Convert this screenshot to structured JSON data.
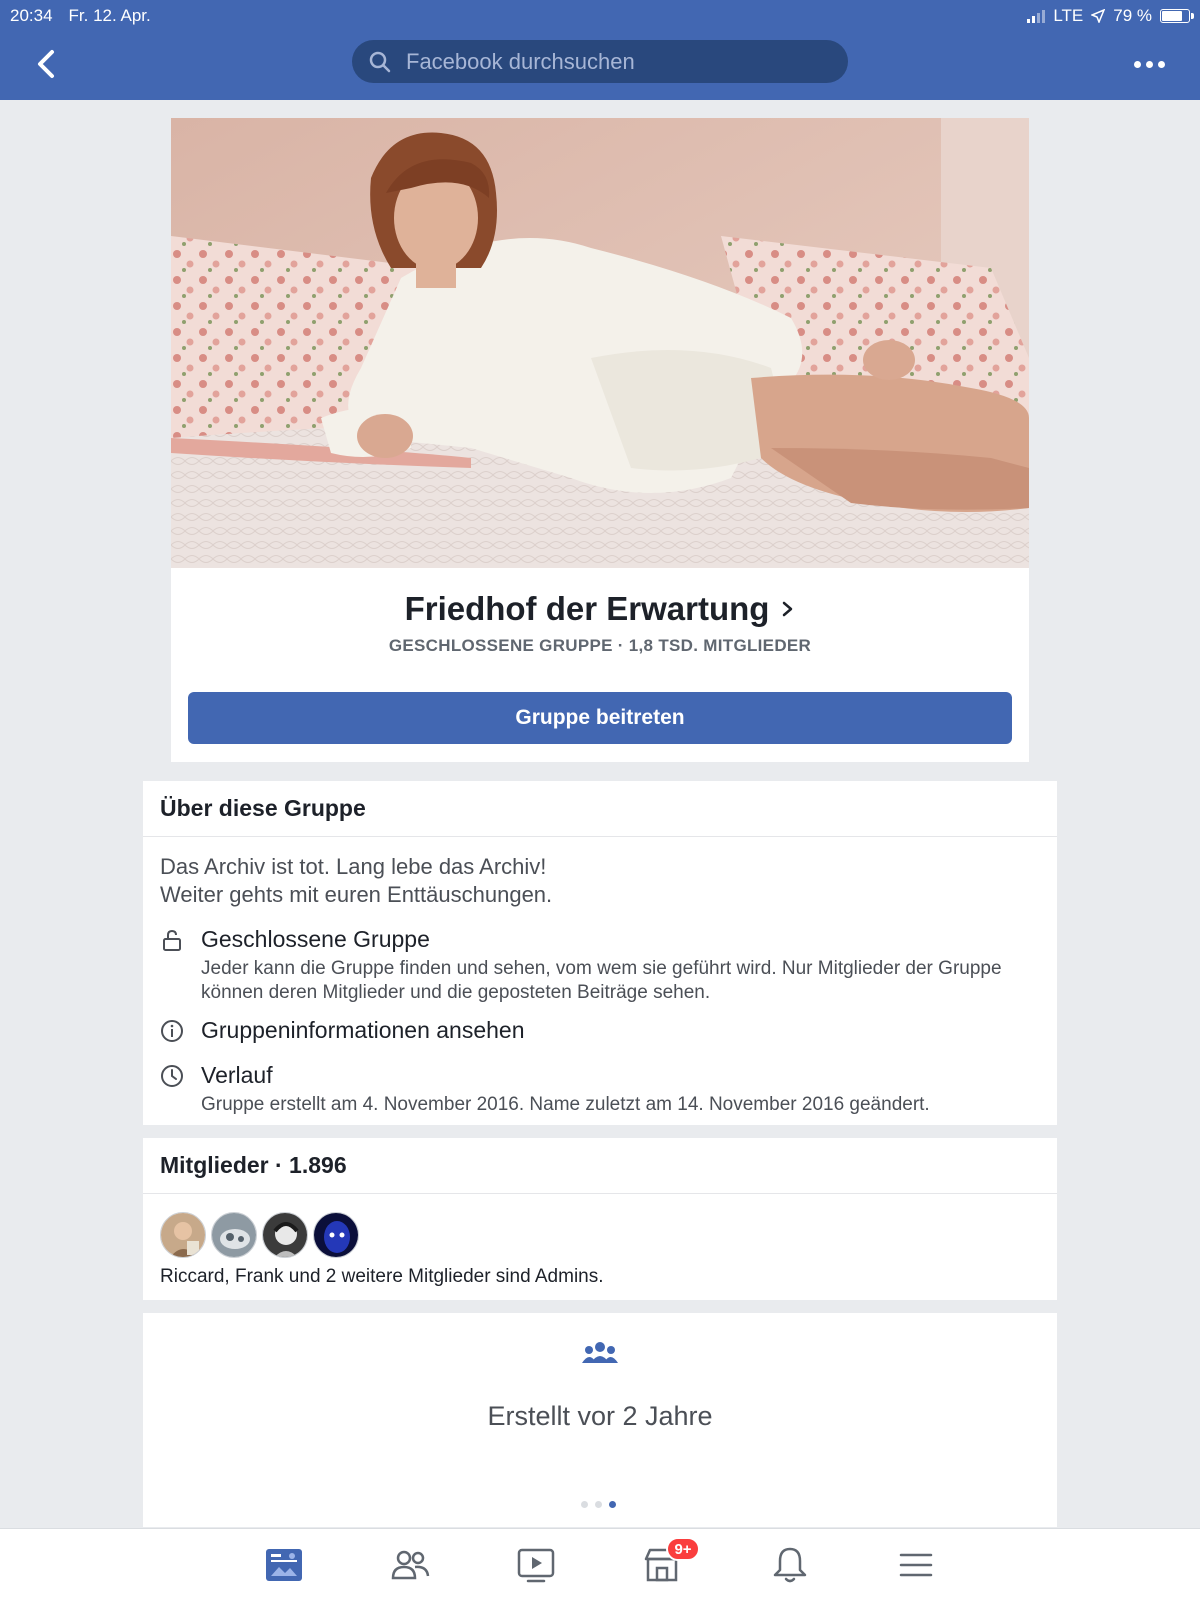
{
  "status_bar": {
    "time": "20:34",
    "date": "Fr. 12. Apr.",
    "network": "LTE",
    "battery": "79 %",
    "battery_level": 0.79
  },
  "header": {
    "search_placeholder": "Facebook durchsuchen",
    "back_icon": "chevron-left-icon",
    "more_icon": "more-dots-icon",
    "bg_color": "#4267b2"
  },
  "group": {
    "name": "Friedhof der Erwartung",
    "subtitle": "GESCHLOSSENE GRUPPE · 1,8 TSD. MITGLIEDER",
    "join_label": "Gruppe beitreten"
  },
  "about": {
    "heading": "Über diese Gruppe",
    "description_line1": "Das Archiv ist tot. Lang lebe das Archiv!",
    "description_line2": "Weiter gehts mit euren Enttäuschungen.",
    "privacy_title": "Geschlossene Gruppe",
    "privacy_text": "Jeder kann die Gruppe finden und sehen, vom wem sie geführt wird. Nur Mitglieder der Gruppe können deren Mitglieder und die geposteten Beiträge sehen.",
    "info_link": "Gruppeninformationen ansehen",
    "history_title": "Verlauf",
    "history_text": "Gruppe erstellt am 4. November 2016. Name zuletzt am 14. November 2016 geändert."
  },
  "members": {
    "heading": "Mitglieder · 1.896",
    "admins_text": "Riccard, Frank und 2 weitere Mitglieder sind Admins."
  },
  "created": {
    "text": "Erstellt vor 2 Jahre",
    "icon": "group-people-icon"
  },
  "bottom_nav": {
    "items": [
      "news-feed-icon",
      "friends-icon",
      "watch-icon",
      "marketplace-icon",
      "notifications-icon",
      "menu-icon"
    ],
    "marketplace_badge": "9+",
    "accent": "#4267b2"
  }
}
